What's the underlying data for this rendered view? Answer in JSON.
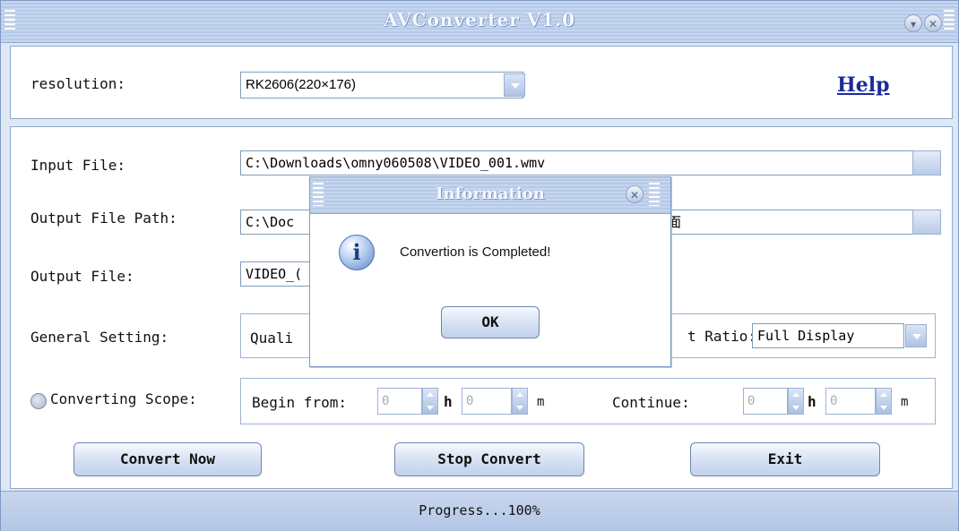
{
  "window": {
    "title": "AVConverter V1.0",
    "minimize_glyph": "▾",
    "close_glyph": "✕"
  },
  "top": {
    "resolution_label": "resolution:",
    "resolution_value": "RK2606(220×176)",
    "help_label": "Help"
  },
  "form": {
    "input_file_label": "Input File:",
    "input_file_value": "C:\\Downloads\\omny060508\\VIDEO_001.wmv",
    "output_path_label": "Output File Path:",
    "output_path_value_left": "C:\\Doc",
    "output_path_value_right": "面",
    "output_file_label": "Output File:",
    "output_file_value": "VIDEO_(",
    "general_setting_label": "General Setting:",
    "quality_partial": "Quali",
    "aspect_partial": "t Ratio:",
    "aspect_value": "Full Display"
  },
  "scope": {
    "label": "Converting Scope:",
    "begin_from_label": "Begin from:",
    "begin_h_value": "0",
    "begin_m_value": "0",
    "h_unit": "h",
    "m_unit": "m",
    "continue_label": "Continue:",
    "cont_h_value": "0",
    "cont_m_value": "0"
  },
  "buttons": {
    "convert_now": "Convert Now",
    "stop_convert": "Stop Convert",
    "exit": "Exit"
  },
  "status": {
    "progress_text": "Progress...100%"
  },
  "dialog": {
    "title": "Information",
    "message": "Convertion is Completed!",
    "ok_label": "OK",
    "icon": "info-icon",
    "close_glyph": "✕"
  }
}
